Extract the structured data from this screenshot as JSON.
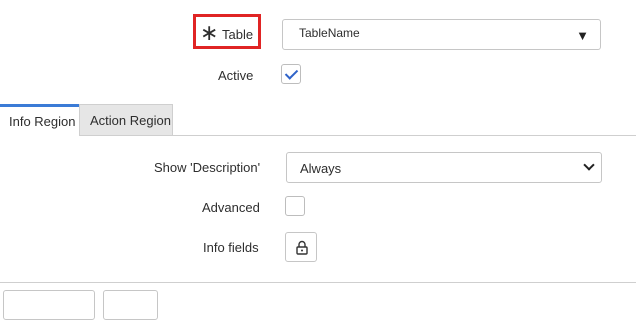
{
  "form": {
    "table": {
      "required_mark": "∗",
      "label": "Table",
      "value": "TableName",
      "caret": "▼"
    },
    "active": {
      "label": "Active",
      "checked": true
    }
  },
  "tabs": [
    {
      "label": "Info Region",
      "selected": true
    },
    {
      "label": "Action Region",
      "selected": false
    }
  ],
  "info_region": {
    "show_description": {
      "label": "Show 'Description'",
      "value": "Always"
    },
    "advanced": {
      "label": "Advanced",
      "checked": false
    },
    "info_fields": {
      "label": "Info fields",
      "icon": "lock-icon"
    }
  },
  "colors": {
    "highlight": "#e02424",
    "accent": "#3b7bd6",
    "check": "#2f63c9"
  }
}
